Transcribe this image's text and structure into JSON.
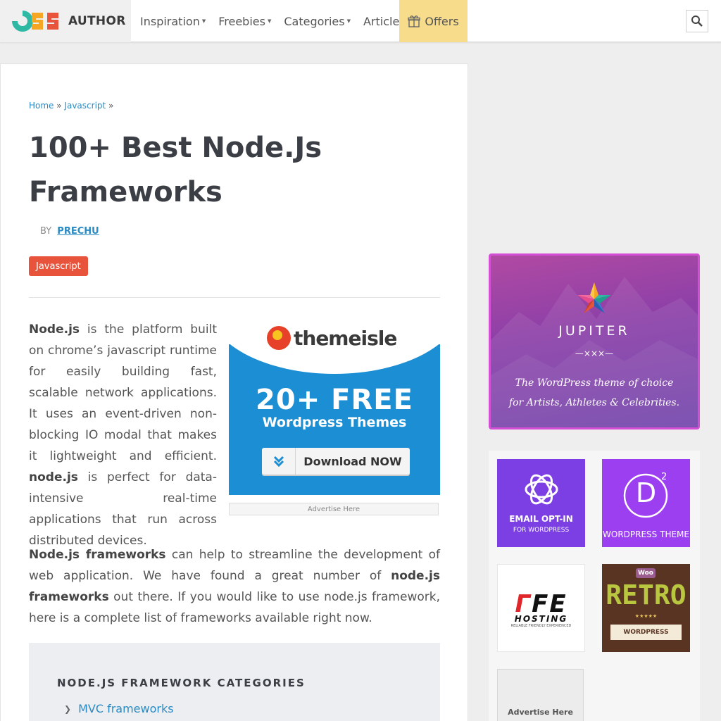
{
  "header": {
    "logo_mark": "CSS",
    "logo_word": "AUTHOR",
    "nav": [
      {
        "label": "Inspiration",
        "dropdown": true
      },
      {
        "label": "Freebies",
        "dropdown": true
      },
      {
        "label": "Categories",
        "dropdown": true
      },
      {
        "label": "Articles",
        "dropdown": false
      }
    ],
    "offers_label": "Offers",
    "search_icon": "search-icon"
  },
  "article": {
    "breadcrumb": {
      "home": "Home",
      "sep1": "»",
      "section": "Javascript",
      "sep2": "»"
    },
    "title": "100+ Best Node.Js Frameworks",
    "byline_prefix": "BY",
    "author": "PRECHU",
    "tag": "Javascript",
    "p1": {
      "b1": "Node.js",
      "t1": " is the platform built on chrome’s javascript runtime for easily building fast, scalable network applications. It uses an event-driven non-blocking IO modal that makes it lightweight and efficient. ",
      "b2": "node.js",
      "t2": " is perfect for data-intensive real-time applications that run across distributed devices."
    },
    "p2": {
      "b1": "Node.js frameworks",
      "t1": " can help to streamline the development of web application. We have found a great number of ",
      "b2": "node.js frameworks",
      "t2": " out there. If you would like to use node.js framework, here is a complete list of frameworks available right now."
    },
    "ad": {
      "brand": "themeisle",
      "headline": "20+ FREE",
      "subline": "Wordpress Themes",
      "button": "Download NOW",
      "caption": "Advertise Here"
    },
    "categories": {
      "title": "NODE.JS FRAMEWORK CATEGORIES",
      "items": [
        "MVC frameworks"
      ]
    }
  },
  "sidebar": {
    "jupiter": {
      "name": "JUPITER",
      "ornament": "—×××—",
      "line1": "The WordPress theme of choice",
      "line2": "for Artists, Athletes & Celebrities."
    },
    "ads": [
      {
        "line1": "EMAIL OPT-IN",
        "line2": "FOR WORDPRESS"
      },
      {
        "line1": "WORDPRESS THEME",
        "mark": "D",
        "sup": "2"
      },
      {
        "brand": "FE",
        "line1": "HOSTING",
        "line2": "RELIABLE FRIENDLY EXPERIENCED"
      },
      {
        "badge": "Woo",
        "title": "RETRO",
        "stars": "★★★★★",
        "ribbon": "WORDPRESS"
      },
      {
        "label": "Advertise Here"
      }
    ]
  },
  "colors": {
    "accent_blue": "#2a8bc4",
    "tag_red": "#e8533c",
    "offers_bg": "#f7dc8c",
    "ad_blue": "#1c8ed3"
  }
}
